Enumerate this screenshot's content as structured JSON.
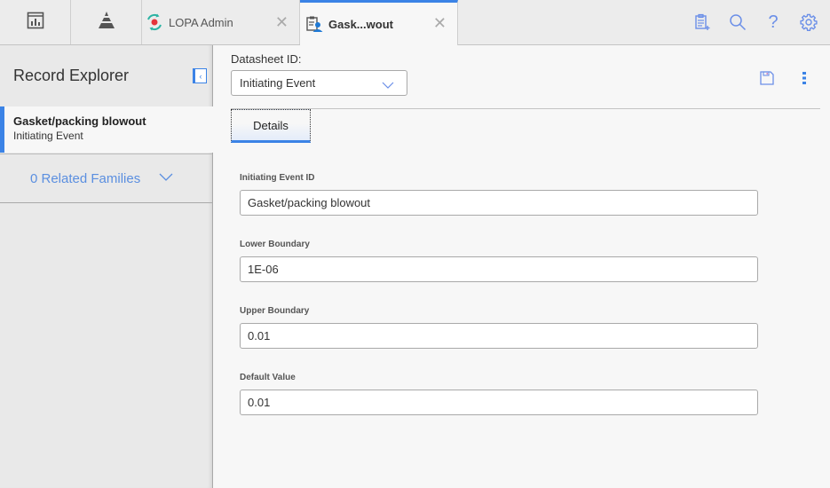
{
  "topbar": {
    "nav": [
      {
        "icon": "dashboard-icon"
      },
      {
        "icon": "pyramid-icon"
      }
    ],
    "tabs": [
      {
        "label": "LOPA Admin",
        "icon": "lopa-admin-icon",
        "active": false
      },
      {
        "label": "Gask...wout",
        "icon": "record-icon",
        "active": true
      }
    ],
    "actions": [
      {
        "icon": "new-record-icon"
      },
      {
        "icon": "search-icon"
      },
      {
        "icon": "help-icon",
        "glyph": "?"
      },
      {
        "icon": "gear-icon"
      }
    ]
  },
  "sidebar": {
    "title": "Record Explorer",
    "collapse_glyph": "‹",
    "record": {
      "name": "Gasket/packing blowout",
      "family": "Initiating Event"
    },
    "related": "0 Related Families"
  },
  "main": {
    "datasheet_label": "Datasheet ID:",
    "datasheet_value": "Initiating Event",
    "details_tab": "Details",
    "fields": [
      {
        "label": "Initiating Event ID",
        "value": "Gasket/packing blowout"
      },
      {
        "label": "Lower Boundary",
        "value": "1E-06"
      },
      {
        "label": "Upper Boundary",
        "value": "0.01"
      },
      {
        "label": "Default Value",
        "value": "0.01"
      }
    ]
  },
  "colors": {
    "accent": "#3b83e6",
    "link": "#5b8fe0",
    "icon": "#6b8fe8",
    "lopa_red": "#e5333b",
    "lopa_teal": "#2bb3a3"
  }
}
